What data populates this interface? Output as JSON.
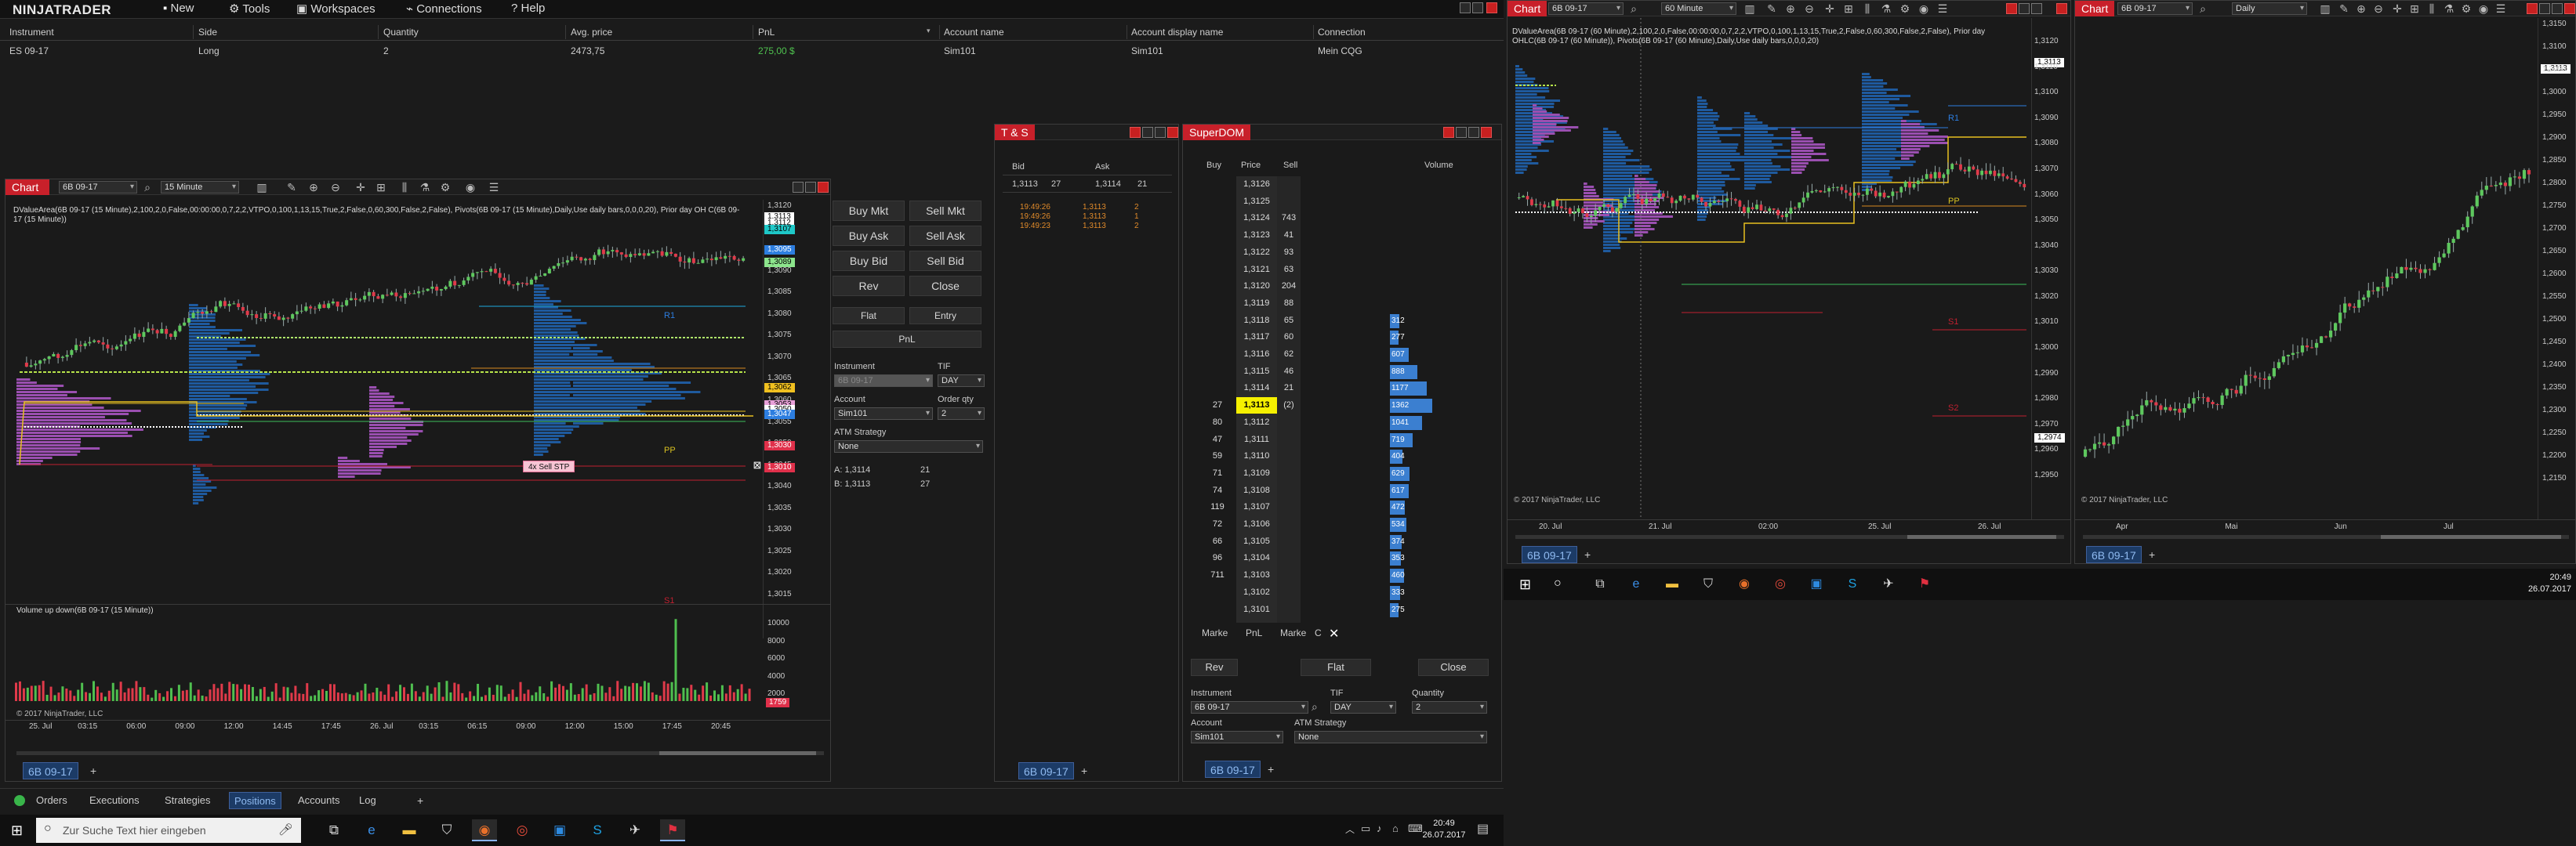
{
  "app": {
    "logo": "NINJATRADER",
    "menu": [
      {
        "label": "New",
        "icon": "new-icon"
      },
      {
        "label": "Tools",
        "icon": "tools-icon"
      },
      {
        "label": "Workspaces",
        "icon": "workspaces-icon"
      },
      {
        "label": "Connections",
        "icon": "connections-icon"
      },
      {
        "label": "Help",
        "icon": "help-icon"
      }
    ],
    "colors": {
      "accent": "#c8202a",
      "bg": "#1a1a1a",
      "tabSelected": "#1c3b66",
      "positive": "#4fc24f",
      "value_area": "#1f5a9e",
      "purple": "#9a4fb0"
    }
  },
  "positions": {
    "headers": [
      "Instrument",
      "Side",
      "Quantity",
      "Avg. price",
      "PnL",
      "Account name",
      "Account display name",
      "Connection"
    ],
    "rows": [
      [
        "ES 09-17",
        "Long",
        "2",
        "2473,75",
        "275,00 $",
        "Sim101",
        "Sim101",
        "Mein CQG"
      ]
    ]
  },
  "bottom_tabs": {
    "items": [
      "Orders",
      "Executions",
      "Strategies",
      "Positions",
      "Accounts",
      "Log"
    ],
    "selected": "Positions"
  },
  "chart1": {
    "tag": "Chart",
    "instrument": "6B 09-17",
    "interval": "15 Minute",
    "header_text": "DValueArea(6B 09-17 (15 Minute),2,100,2,0,False,00:00:00,0,7,2,2,VTPO,0,100,1,13,15,True,2,False,0,60,300,False,2,False), Pivots(6B 09-17 (15 Minute),Daily,Use daily bars,0,0,0,20), Prior day OH C(6B 09-17 (15 Minute))",
    "price_ticks": [
      "1,3120",
      "1,3110",
      "1,3100",
      "1,3090",
      "1,3085",
      "1,3080",
      "1,3075",
      "1,3070",
      "1,3065",
      "1,3060",
      "1,3055",
      "1,3050",
      "1,3045",
      "1,3040",
      "1,3035",
      "1,3030",
      "1,3025",
      "1,3020",
      "1,3015"
    ],
    "price_boxes": [
      {
        "label": "1,3113",
        "color": "#ffffff"
      },
      {
        "label": "1,3112",
        "color": "#ffffff"
      },
      {
        "label": "1,3107",
        "color": "#1ec8c8"
      },
      {
        "label": "1,3095",
        "color": "#2d7ee0"
      },
      {
        "label": "1,3089",
        "color": "#8de58d"
      },
      {
        "label": "1,3062",
        "color": "#f0c020"
      },
      {
        "label": "1,3053",
        "color": "#e8a0d8"
      },
      {
        "label": "1,3050",
        "color": "#ffffff"
      },
      {
        "label": "1,3047",
        "color": "#2d7ee0"
      },
      {
        "label": "1,3030",
        "color": "#e0304a"
      },
      {
        "label": "1,3010",
        "color": "#e0304a"
      }
    ],
    "pivot_labels": [
      "R1",
      "PP",
      "S1"
    ],
    "order_label": "4x  Sell STP",
    "time_labels": [
      "25. Jul",
      "03:15",
      "06:00",
      "09:00",
      "12:00",
      "14:45",
      "17:45",
      "26. Jul",
      "03:15",
      "06:15",
      "09:00",
      "12:00",
      "15:00",
      "17:45",
      "20:45"
    ],
    "volume_title": "Volume up down(6B 09-17 (15 Minute))",
    "volume_ticks": [
      "10000",
      "8000",
      "6000",
      "4000",
      "2000"
    ],
    "volume_box": "1759",
    "copyright": "© 2017 NinjaTrader, LLC",
    "tab_label": "6B 09-17"
  },
  "chart_trader": {
    "buttons": [
      "Buy Mkt",
      "Sell Mkt",
      "Buy Ask",
      "Sell Ask",
      "Buy Bid",
      "Sell Bid",
      "Rev",
      "Close",
      "Flat",
      "Entry",
      "PnL"
    ],
    "instrument_label": "Instrument",
    "instrument_value": "6B 09-17",
    "tif_label": "TIF",
    "tif_value": "DAY",
    "account_label": "Account",
    "account_value": "Sim101",
    "qty_label": "Order qty",
    "qty_value": "2",
    "atm_label": "ATM Strategy",
    "atm_value": "None",
    "ask_line": "A: 1,3114",
    "ask_size": "21",
    "bid_line": "B: 1,3113",
    "bid_size": "27"
  },
  "ts": {
    "tag": "T & S",
    "bid_label": "Bid",
    "ask_label": "Ask",
    "bid_price": "1,3113",
    "bid_size": "27",
    "ask_price": "1,3114",
    "ask_size": "21",
    "trades": [
      [
        "19:49:26",
        "1,3113",
        "2"
      ],
      [
        "19:49:26",
        "1,3113",
        "1"
      ],
      [
        "19:49:23",
        "1,3113",
        "2"
      ]
    ],
    "tab_label": "6B 09-17"
  },
  "superdom": {
    "tag": "SuperDOM",
    "headers": [
      "Buy",
      "Price",
      "Sell",
      "Volume"
    ],
    "rows": [
      {
        "buy": "",
        "price": "1,3126",
        "sell": "",
        "vol": ""
      },
      {
        "buy": "",
        "price": "1,3125",
        "sell": "",
        "vol": ""
      },
      {
        "buy": "",
        "price": "1,3124",
        "sell": "743",
        "vol": ""
      },
      {
        "buy": "",
        "price": "1,3123",
        "sell": "41",
        "vol": ""
      },
      {
        "buy": "",
        "price": "1,3122",
        "sell": "93",
        "vol": ""
      },
      {
        "buy": "",
        "price": "1,3121",
        "sell": "63",
        "vol": ""
      },
      {
        "buy": "",
        "price": "1,3120",
        "sell": "204",
        "vol": ""
      },
      {
        "buy": "",
        "price": "1,3119",
        "sell": "88",
        "vol": ""
      },
      {
        "buy": "",
        "price": "1,3118",
        "sell": "65",
        "vol": "312"
      },
      {
        "buy": "",
        "price": "1,3117",
        "sell": "60",
        "vol": "277"
      },
      {
        "buy": "",
        "price": "1,3116",
        "sell": "62",
        "vol": "607"
      },
      {
        "buy": "",
        "price": "1,3115",
        "sell": "46",
        "vol": "888"
      },
      {
        "buy": "",
        "price": "1,3114",
        "sell": "21",
        "vol": "1177"
      },
      {
        "buy": "27",
        "price": "1,3113",
        "sell": "(2)",
        "vol": "1362"
      },
      {
        "buy": "80",
        "price": "1,3112",
        "sell": "",
        "vol": "1041"
      },
      {
        "buy": "47",
        "price": "1,3111",
        "sell": "",
        "vol": "719"
      },
      {
        "buy": "59",
        "price": "1,3110",
        "sell": "",
        "vol": "404"
      },
      {
        "buy": "71",
        "price": "1,3109",
        "sell": "",
        "vol": "629"
      },
      {
        "buy": "74",
        "price": "1,3108",
        "sell": "",
        "vol": "617"
      },
      {
        "buy": "119",
        "price": "1,3107",
        "sell": "",
        "vol": "472"
      },
      {
        "buy": "72",
        "price": "1,3106",
        "sell": "",
        "vol": "534"
      },
      {
        "buy": "66",
        "price": "1,3105",
        "sell": "",
        "vol": "374"
      },
      {
        "buy": "96",
        "price": "1,3104",
        "sell": "",
        "vol": "353"
      },
      {
        "buy": "711",
        "price": "1,3103",
        "sell": "",
        "vol": "460"
      },
      {
        "buy": "",
        "price": "1,3102",
        "sell": "",
        "vol": "333"
      },
      {
        "buy": "",
        "price": "1,3101",
        "sell": "",
        "vol": "275"
      }
    ],
    "current_price": "1,3113",
    "footer": [
      "Marke",
      "PnL",
      "Marke",
      "C"
    ],
    "buttons": [
      "Rev",
      "Flat",
      "Close"
    ],
    "instrument_label": "Instrument",
    "instrument_value": "6B 09-17",
    "tif_label": "TIF",
    "tif_value": "DAY",
    "qty_label": "Quantity",
    "qty_value": "2",
    "account_label": "Account",
    "account_value": "Sim101",
    "atm_label": "ATM Strategy",
    "atm_value": "None",
    "tab_label": "6B 09-17"
  },
  "chart2": {
    "tag": "Chart",
    "instrument": "6B 09-17",
    "interval": "60 Minute",
    "header_text": "DValueArea(6B 09-17 (60 Minute),2,100,2,0,False,00:00:00,0,7,2,2,VTPO,0,100,1,13,15,True,2,False,0,60,300,False,2,False), Prior day OHLC(6B 09-17 (60 Minute)), Pivots(6B 09-17 (60 Minute),Daily,Use daily bars,0,0,0,20)",
    "price_ticks": [
      "1,3120",
      "1,3110",
      "1,3100",
      "1,3090",
      "1,3080",
      "1,3070",
      "1,3060",
      "1,3050",
      "1,3040",
      "1,3030",
      "1,3020",
      "1,3010",
      "1,3000",
      "1,2990",
      "1,2980",
      "1,2970",
      "1,2960",
      "1,2950"
    ],
    "price_boxes": [
      "1,3113",
      "1,2974"
    ],
    "pivot_labels": [
      "R1",
      "PP",
      "S1",
      "S2"
    ],
    "time_labels": [
      "20. Jul",
      "21. Jul",
      "02:00",
      "25. Jul",
      "26. Jul"
    ],
    "copyright": "© 2017 NinjaTrader, LLC",
    "tab_label": "6B 09-17"
  },
  "chart3": {
    "tag": "Chart",
    "instrument": "6B 09-17",
    "interval": "Daily",
    "price_ticks": [
      "1,3150",
      "1,3100",
      "1,3050",
      "1,3000",
      "1,2950",
      "1,2900",
      "1,2850",
      "1,2800",
      "1,2750",
      "1,2700",
      "1,2650",
      "1,2600",
      "1,2550",
      "1,2500",
      "1,2450",
      "1,2400",
      "1,2350",
      "1,2300",
      "1,2250",
      "1,2200",
      "1,2150"
    ],
    "price_box": "1,3113",
    "time_labels": [
      "Apr",
      "Mai",
      "Jun",
      "Jul"
    ],
    "copyright": "© 2017 NinjaTrader, LLC",
    "tab_label": "6B 09-17"
  },
  "taskbar": {
    "search_placeholder": "Zur Suche Text hier eingeben",
    "time": "20:49",
    "date": "26.07.2017",
    "right_time": "20:49",
    "right_date": "26.07.2017",
    "app_icons": [
      "task-view-icon",
      "edge-icon",
      "explorer-icon",
      "store-icon",
      "firefox-icon",
      "chrome-icon",
      "app-icon",
      "skype-icon",
      "ninja-icon",
      "ninjatrader-icon"
    ]
  }
}
